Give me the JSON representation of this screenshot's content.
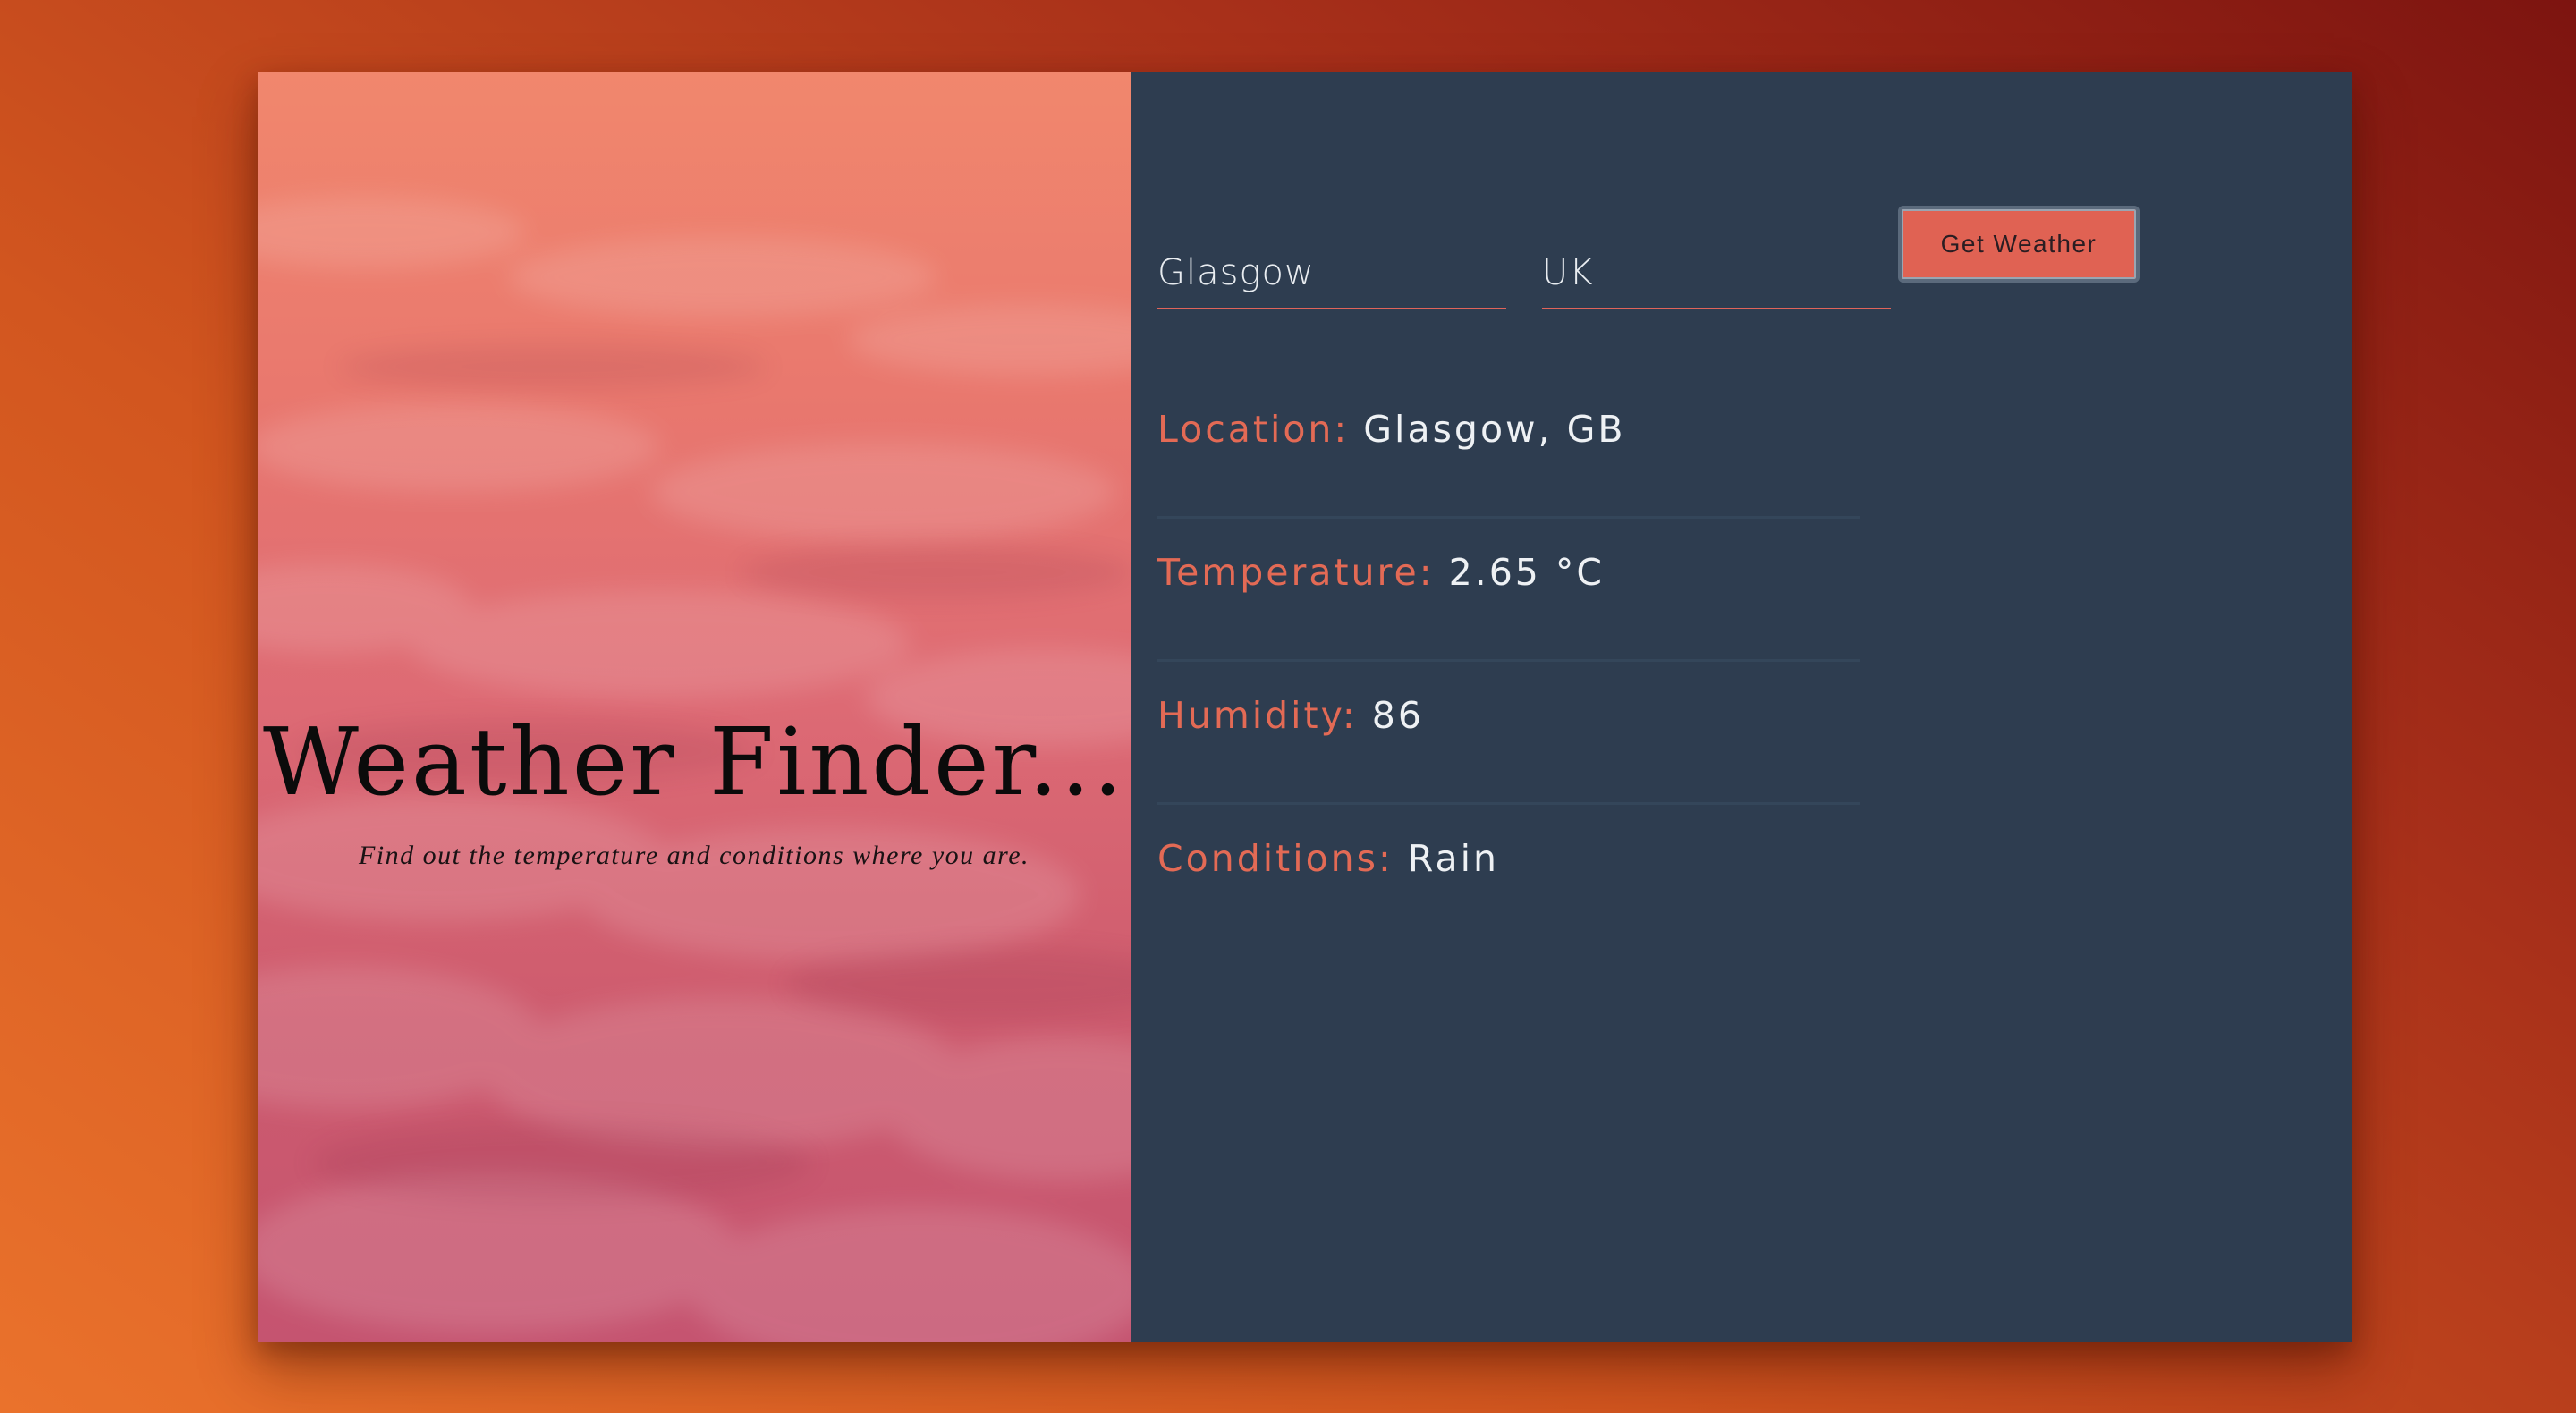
{
  "hero": {
    "title": "Weather Finder...",
    "subtitle": "Find out the temperature and conditions where you are."
  },
  "form": {
    "city_value": "Glasgow",
    "country_value": "UK",
    "submit_label": "Get Weather"
  },
  "results": [
    {
      "label": "Location:",
      "value": "Glasgow, GB"
    },
    {
      "label": "Temperature:",
      "value": "2.65 °C"
    },
    {
      "label": "Humidity:",
      "value": "86"
    },
    {
      "label": "Conditions:",
      "value": "Rain"
    }
  ],
  "colors": {
    "accent": "#e36a55",
    "panel": "#2e3d50",
    "button": "#e06253"
  }
}
